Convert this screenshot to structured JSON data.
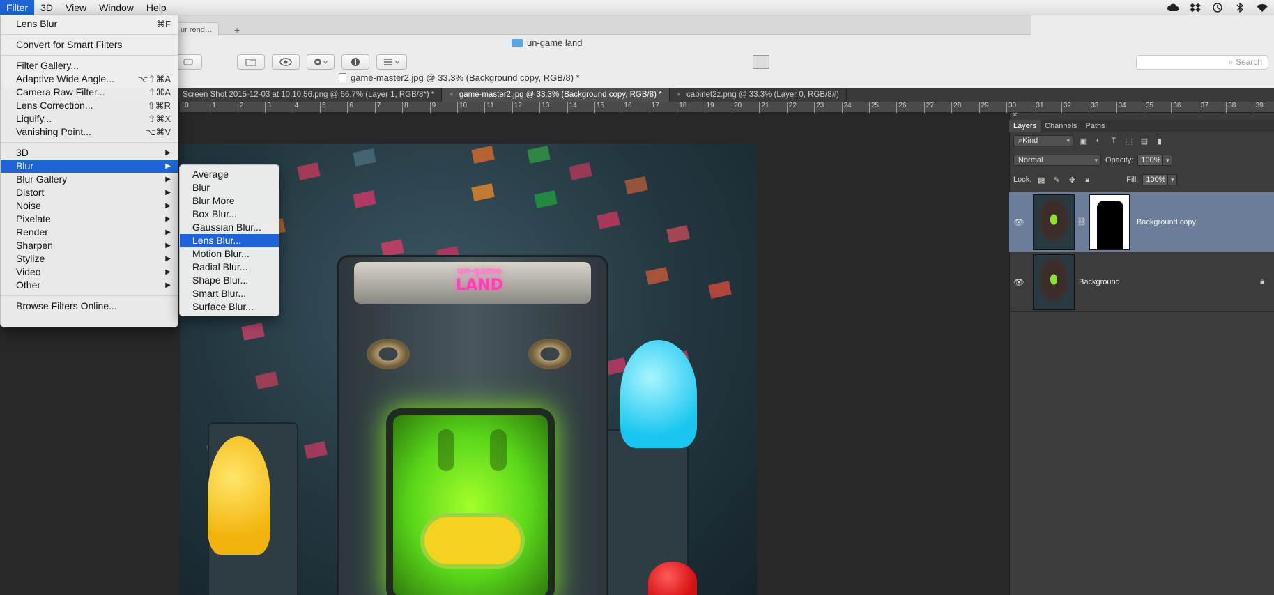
{
  "menubar": {
    "items": [
      {
        "label": "Filter",
        "active": true
      },
      {
        "label": "3D",
        "active": false
      },
      {
        "label": "View",
        "active": false
      },
      {
        "label": "Window",
        "active": false
      },
      {
        "label": "Help",
        "active": false
      }
    ],
    "system_icons": [
      "creative-cloud-icon",
      "dropbox-icon",
      "time-machine-icon",
      "bluetooth-icon",
      "wifi-icon"
    ]
  },
  "finder": {
    "tab_partial": "ur rend…",
    "tab_plus": "+",
    "folder_title": "un-game land",
    "search_placeholder": "Search",
    "doc_title": "game-master2.jpg @ 33.3% (Background copy, RGB/8) *"
  },
  "doc_tabs": [
    {
      "label": "Screen Shot 2015-12-03 at 10.10.56.png @ 66.7% (Layer 1, RGB/8*) *",
      "active": false,
      "close": "×"
    },
    {
      "label": "game-master2.jpg @ 33.3% (Background copy, RGB/8) *",
      "active": true,
      "close": "×"
    },
    {
      "label": "cabinet2z.png @ 33.3% (Layer 0, RGB/8#)",
      "active": false,
      "close": "×"
    }
  ],
  "ruler": {
    "labels": [
      "0",
      "1",
      "2",
      "3",
      "4",
      "5",
      "6",
      "7",
      "8",
      "9",
      "10",
      "11",
      "12",
      "13",
      "14",
      "15",
      "16",
      "17",
      "18",
      "19",
      "20",
      "21",
      "22",
      "23",
      "24",
      "25",
      "26",
      "27",
      "28",
      "29",
      "30",
      "31",
      "32",
      "33",
      "34",
      "35",
      "36",
      "37",
      "38",
      "39"
    ]
  },
  "artwork": {
    "marquee_top": "un-game",
    "marquee_main": "LAND"
  },
  "filter_menu": {
    "items": [
      {
        "label": "Lens Blur",
        "shortcut": "⌘F"
      },
      {
        "sep": true
      },
      {
        "label": "Convert for Smart Filters",
        "shortcut": ""
      },
      {
        "sep": true
      },
      {
        "label": "Filter Gallery...",
        "shortcut": ""
      },
      {
        "label": "Adaptive Wide Angle...",
        "shortcut": "⌥⇧⌘A"
      },
      {
        "label": "Camera Raw Filter...",
        "shortcut": "⇧⌘A"
      },
      {
        "label": "Lens Correction...",
        "shortcut": "⇧⌘R"
      },
      {
        "label": "Liquify...",
        "shortcut": "⇧⌘X"
      },
      {
        "label": "Vanishing Point...",
        "shortcut": "⌥⌘V"
      },
      {
        "sep": true
      },
      {
        "label": "3D",
        "submenu": true
      },
      {
        "label": "Blur",
        "submenu": true,
        "highlight": true
      },
      {
        "label": "Blur Gallery",
        "submenu": true
      },
      {
        "label": "Distort",
        "submenu": true
      },
      {
        "label": "Noise",
        "submenu": true
      },
      {
        "label": "Pixelate",
        "submenu": true
      },
      {
        "label": "Render",
        "submenu": true
      },
      {
        "label": "Sharpen",
        "submenu": true
      },
      {
        "label": "Stylize",
        "submenu": true
      },
      {
        "label": "Video",
        "submenu": true
      },
      {
        "label": "Other",
        "submenu": true
      },
      {
        "sep": true
      },
      {
        "label": "Browse Filters Online...",
        "shortcut": ""
      }
    ]
  },
  "blur_submenu": {
    "items": [
      {
        "label": "Average"
      },
      {
        "label": "Blur"
      },
      {
        "label": "Blur More"
      },
      {
        "label": "Box Blur..."
      },
      {
        "label": "Gaussian Blur..."
      },
      {
        "label": "Lens Blur...",
        "highlight": true
      },
      {
        "label": "Motion Blur..."
      },
      {
        "label": "Radial Blur..."
      },
      {
        "label": "Shape Blur..."
      },
      {
        "label": "Smart Blur..."
      },
      {
        "label": "Surface Blur..."
      }
    ]
  },
  "layers_panel": {
    "tabs": [
      "Layers",
      "Channels",
      "Paths"
    ],
    "filter_kind": "Kind",
    "blend_mode": "Normal",
    "opacity_label": "Opacity:",
    "opacity_value": "100%",
    "lock_label": "Lock:",
    "fill_label": "Fill:",
    "fill_value": "100%",
    "layers": [
      {
        "name": "Background copy",
        "selected": true,
        "has_mask": true
      },
      {
        "name": "Background",
        "selected": false,
        "locked": true
      }
    ]
  }
}
